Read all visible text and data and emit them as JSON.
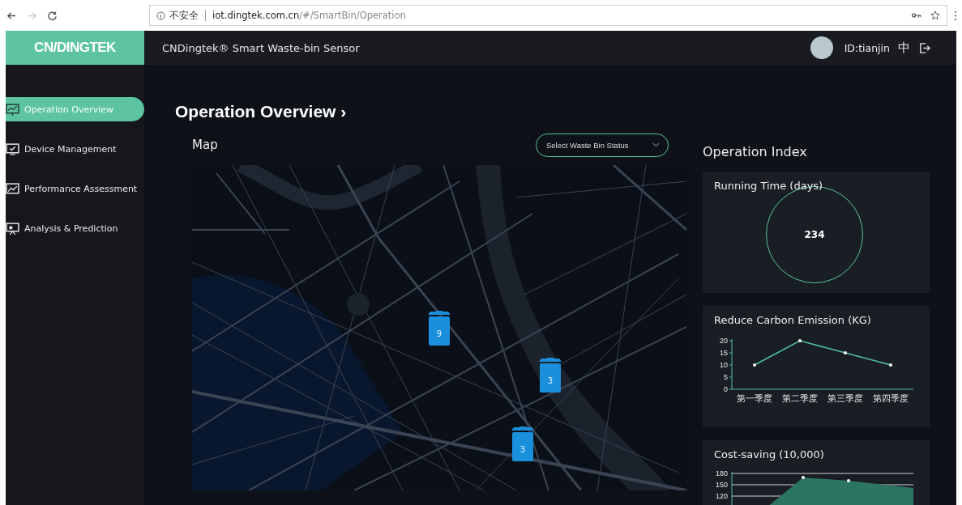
{
  "browser": {
    "security_label": "不安全",
    "url_host": "iot.dingtek.com.cn",
    "url_path": "/#/SmartBin/Operation"
  },
  "header": {
    "logo": "CN/DINGTEK",
    "title": "CNDingtek® Smart Waste-bin Sensor",
    "user_id": "ID:tianjin",
    "language": "中"
  },
  "sidebar": {
    "items": [
      {
        "label": "Operation Overview",
        "selected": true
      },
      {
        "label": "Device Management",
        "selected": false
      },
      {
        "label": "Performance Assessment",
        "selected": false
      },
      {
        "label": "Analysis & Prediction",
        "selected": false
      }
    ]
  },
  "page_title": "Operation Overview ›",
  "map": {
    "title": "Map",
    "status_select": {
      "placeholder": "Select Waste Bin Status"
    },
    "markers": [
      {
        "count": "9"
      },
      {
        "count": "3"
      },
      {
        "count": "3"
      }
    ]
  },
  "operation_index": {
    "title": "Operation Index",
    "cards": [
      {
        "kind": "ring",
        "title": "Running Time (days)",
        "value": "234"
      },
      {
        "kind": "chart",
        "title": "Reduce Carbon Emission (KG)",
        "chart_data": {
          "type": "line",
          "categories": [
            "第一季度",
            "第二季度",
            "第三季度",
            "第四季度"
          ],
          "series": [
            {
              "color": "#4fc3a1",
              "values": [
                10,
                20,
                15,
                10
              ]
            }
          ],
          "ylim": [
            0,
            20
          ],
          "yticks": [
            0,
            5,
            10,
            15,
            20
          ]
        }
      },
      {
        "kind": "sketch",
        "title": "Cost-saving (10,000)",
        "axis_labels": [
          "180",
          "150",
          "120"
        ]
      }
    ]
  }
}
